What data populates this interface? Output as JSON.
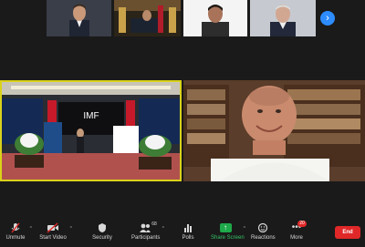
{
  "gallery": {
    "next_page_icon": "chevron-right-icon"
  },
  "toolbar": {
    "unmute_label": "Unmute",
    "start_video_label": "Start Video",
    "security_label": "Security",
    "participants_label": "Participants",
    "participants_count": "68",
    "polls_label": "Polls",
    "share_screen_label": "Share Screen",
    "reactions_label": "Reactions",
    "more_label": "More",
    "more_badge": "20",
    "end_label": "End"
  },
  "colors": {
    "active_speaker_border": "#d9d21a",
    "share_green": "#1ea94a",
    "end_red": "#e02828",
    "accent_blue": "#2d8cff"
  }
}
